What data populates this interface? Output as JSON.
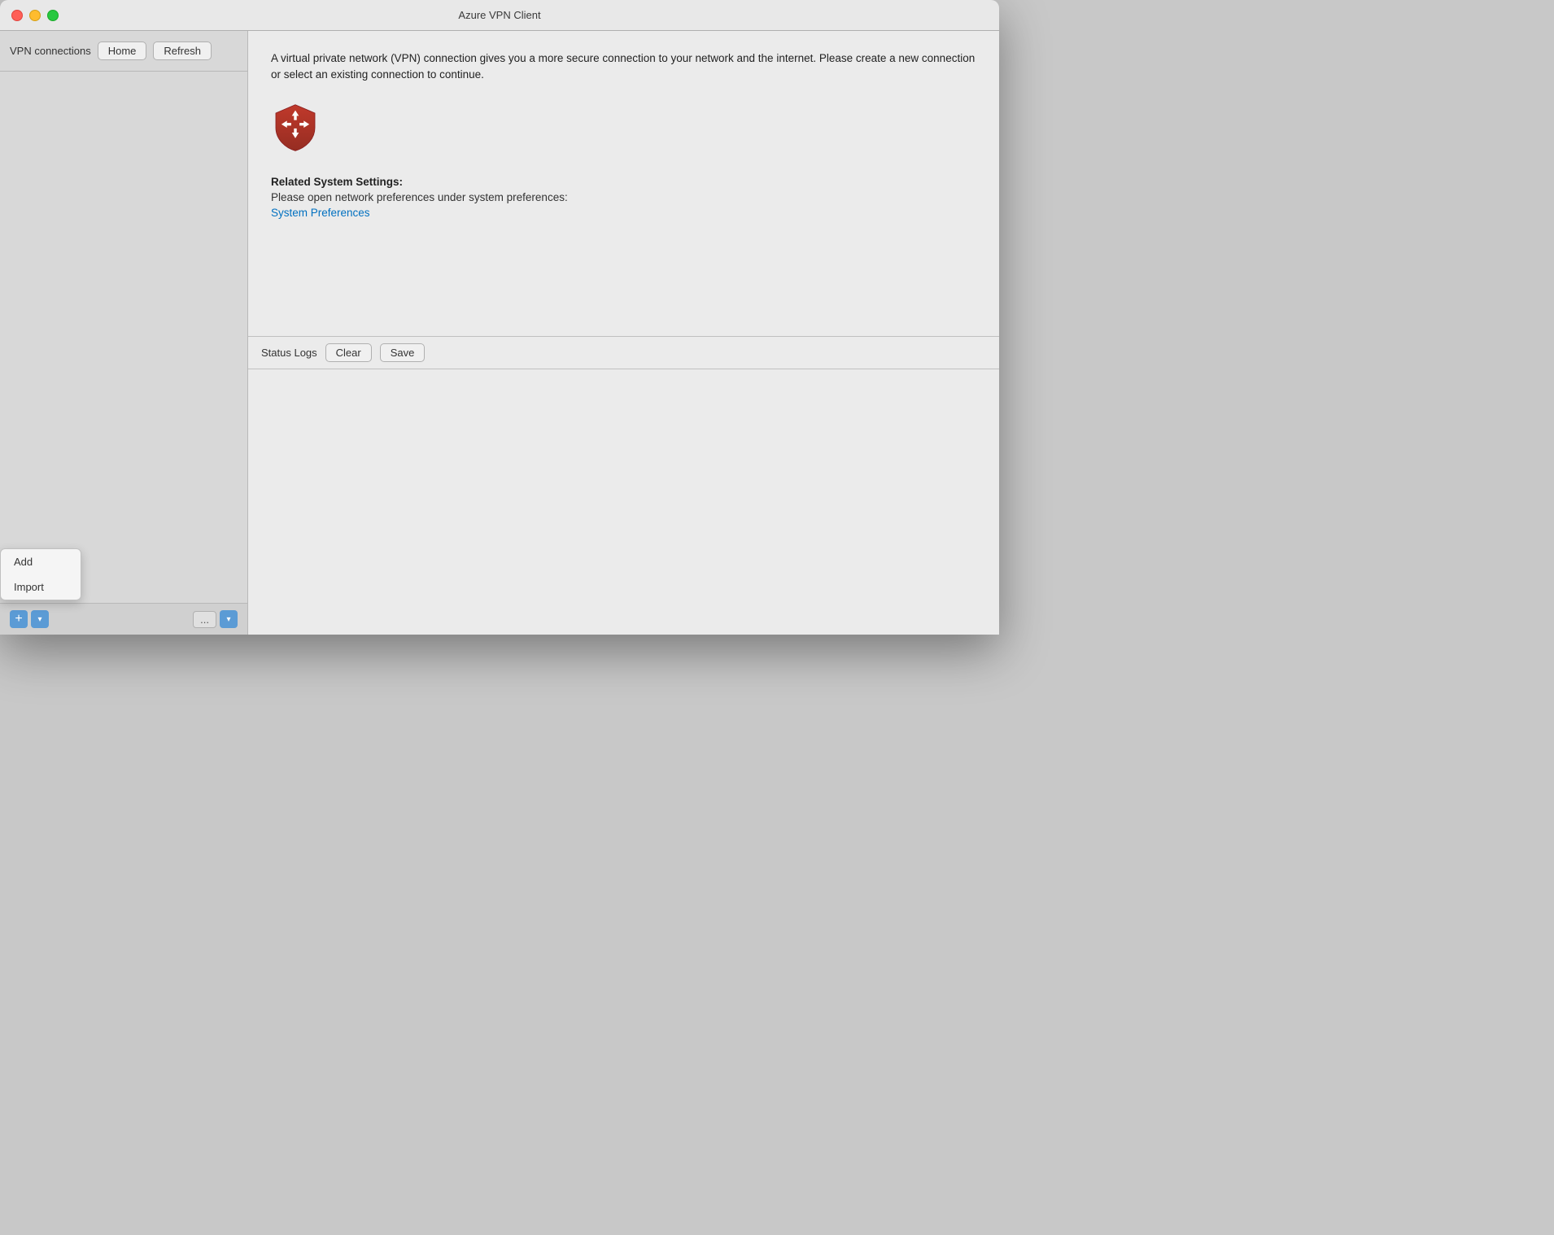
{
  "window": {
    "title": "Azure VPN Client"
  },
  "sidebar": {
    "title": "VPN connections",
    "home_button": "Home",
    "refresh_button": "Refresh",
    "add_button": "+",
    "chevron_down": "▾",
    "ellipsis_button": "...",
    "dropdown": {
      "items": [
        {
          "label": "Add",
          "id": "add"
        },
        {
          "label": "Import",
          "id": "import"
        }
      ]
    }
  },
  "main": {
    "description": "A virtual private network (VPN) connection gives you a more secure connection to your network and the internet. Please create a new connection or select an existing connection to continue.",
    "related_settings_title": "Related System Settings:",
    "related_settings_desc": "Please open network preferences under system preferences:",
    "system_preferences_link": "System Preferences",
    "status_logs_label": "Status Logs",
    "clear_button": "Clear",
    "save_button": "Save"
  },
  "icons": {
    "close": "✕",
    "minimize": "−",
    "maximize": "+"
  }
}
